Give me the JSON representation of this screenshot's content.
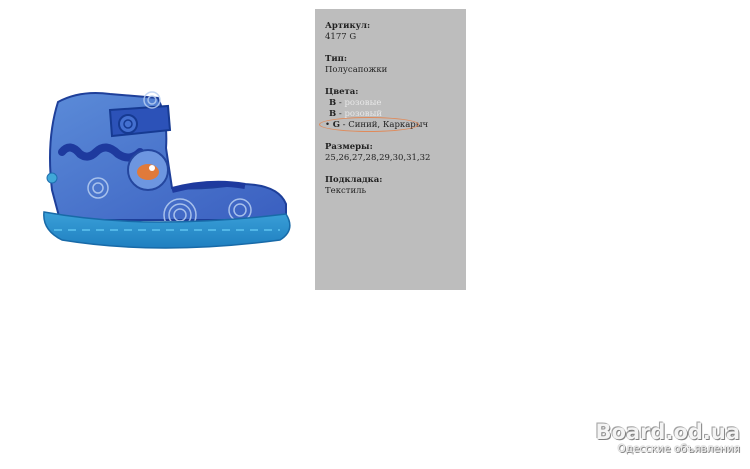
{
  "product": {
    "article_label": "Артикул:",
    "article_value": "4177 G",
    "type_label": "Тип:",
    "type_value": "Полусапожки",
    "colors_label": "Цвета:",
    "colors": [
      {
        "bullet": "",
        "code": "B",
        "sep": " - ",
        "name": "розовые",
        "muted": true
      },
      {
        "bullet": "",
        "code": "B",
        "sep": " - ",
        "name": "розовый",
        "muted": true
      },
      {
        "bullet": "• ",
        "code": "G",
        "sep": " - ",
        "name": "Синий, Каркарыч",
        "muted": false
      }
    ],
    "sizes_label": "Размеры:",
    "sizes_value": "25,26,27,28,29,30,31,32",
    "lining_label": "Подкладка:",
    "lining_value": "Текстиль"
  },
  "watermark": {
    "main": "Board.od.ua",
    "sub": "Одесские объявления"
  }
}
